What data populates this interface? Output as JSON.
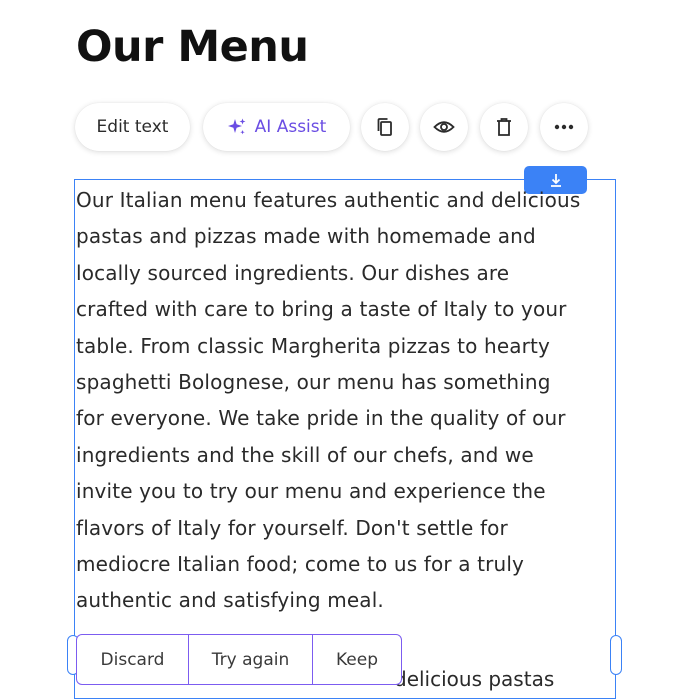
{
  "page": {
    "title": "Our Menu"
  },
  "toolbar": {
    "edit_label": "Edit text",
    "ai_label": "AI Assist",
    "icons": {
      "ai": "sparkle-icon",
      "duplicate": "copy-icon",
      "preview": "eye-icon",
      "delete": "trash-icon",
      "more": "more-horizontal-icon",
      "move": "arrow-down-icon"
    }
  },
  "content": {
    "lines": [
      "Our Italian menu features authentic and delicious",
      "pastas and pizzas made with homemade and",
      "locally sourced ingredients. Our dishes are",
      "crafted with care to bring a taste of Italy to your",
      "table. From classic Margherita pizzas to hearty",
      "spaghetti Bolognese, our menu has something",
      "for everyone. We take pride in the quality of our",
      "ingredients and the skill of our chefs, and we",
      "invite you to try our menu and experience the",
      "flavors of Italy for yourself. Don't settle for",
      "mediocre Italian food; come to us for a truly",
      "authentic and satisfying meal."
    ],
    "next_visible": "delicious pastas"
  },
  "decision": {
    "discard": "Discard",
    "try_again": "Try again",
    "keep": "Keep"
  },
  "colors": {
    "selection": "#3b82f6",
    "ai_accent": "#6a4de3",
    "decision_border": "#7c5cf0"
  }
}
